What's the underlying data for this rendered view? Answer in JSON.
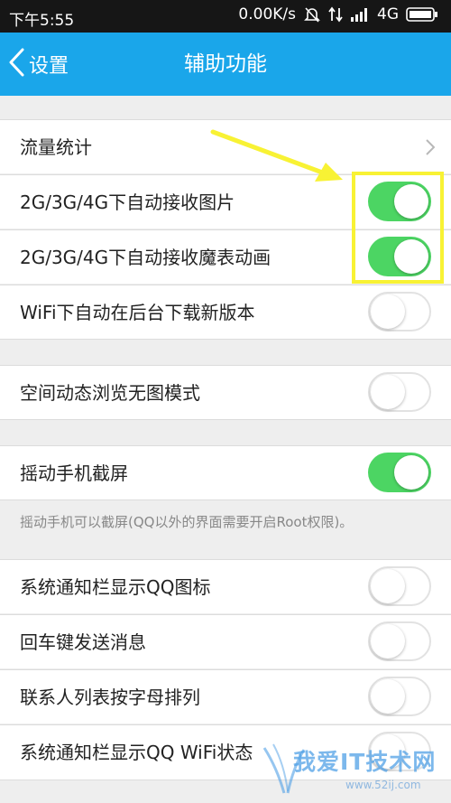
{
  "status_bar": {
    "time": "下午5:55",
    "speed": "0.00K/s",
    "network": "4G"
  },
  "header": {
    "back_label": "设置",
    "title": "辅助功能"
  },
  "settings": [
    {
      "label": "流量统计",
      "type": "link"
    },
    {
      "label": "2G/3G/4G下自动接收图片",
      "type": "toggle",
      "on": true
    },
    {
      "label": "2G/3G/4G下自动接收魔表动画",
      "type": "toggle",
      "on": true
    },
    {
      "label": "WiFi下自动在后台下载新版本",
      "type": "toggle",
      "on": false
    },
    {
      "label": "空间动态浏览无图模式",
      "type": "toggle",
      "on": false
    },
    {
      "label": "摇动手机截屏",
      "type": "toggle",
      "on": true
    },
    {
      "label": "系统通知栏显示QQ图标",
      "type": "toggle",
      "on": false
    },
    {
      "label": "回车键发送消息",
      "type": "toggle",
      "on": false
    },
    {
      "label": "联系人列表按字母排列",
      "type": "toggle",
      "on": false
    },
    {
      "label": "系统通知栏显示QQ WiFi状态",
      "type": "toggle",
      "on": false
    }
  ],
  "shake_hint": "摇动手机可以截屏(QQ以外的界面需要开启Root权限)。",
  "watermark": {
    "main": "我爱IT技术网",
    "url": "www.52ij.com"
  },
  "colors": {
    "header": "#1aa6ea",
    "toggle_on": "#4cd563",
    "annotation": "#f8f234"
  }
}
